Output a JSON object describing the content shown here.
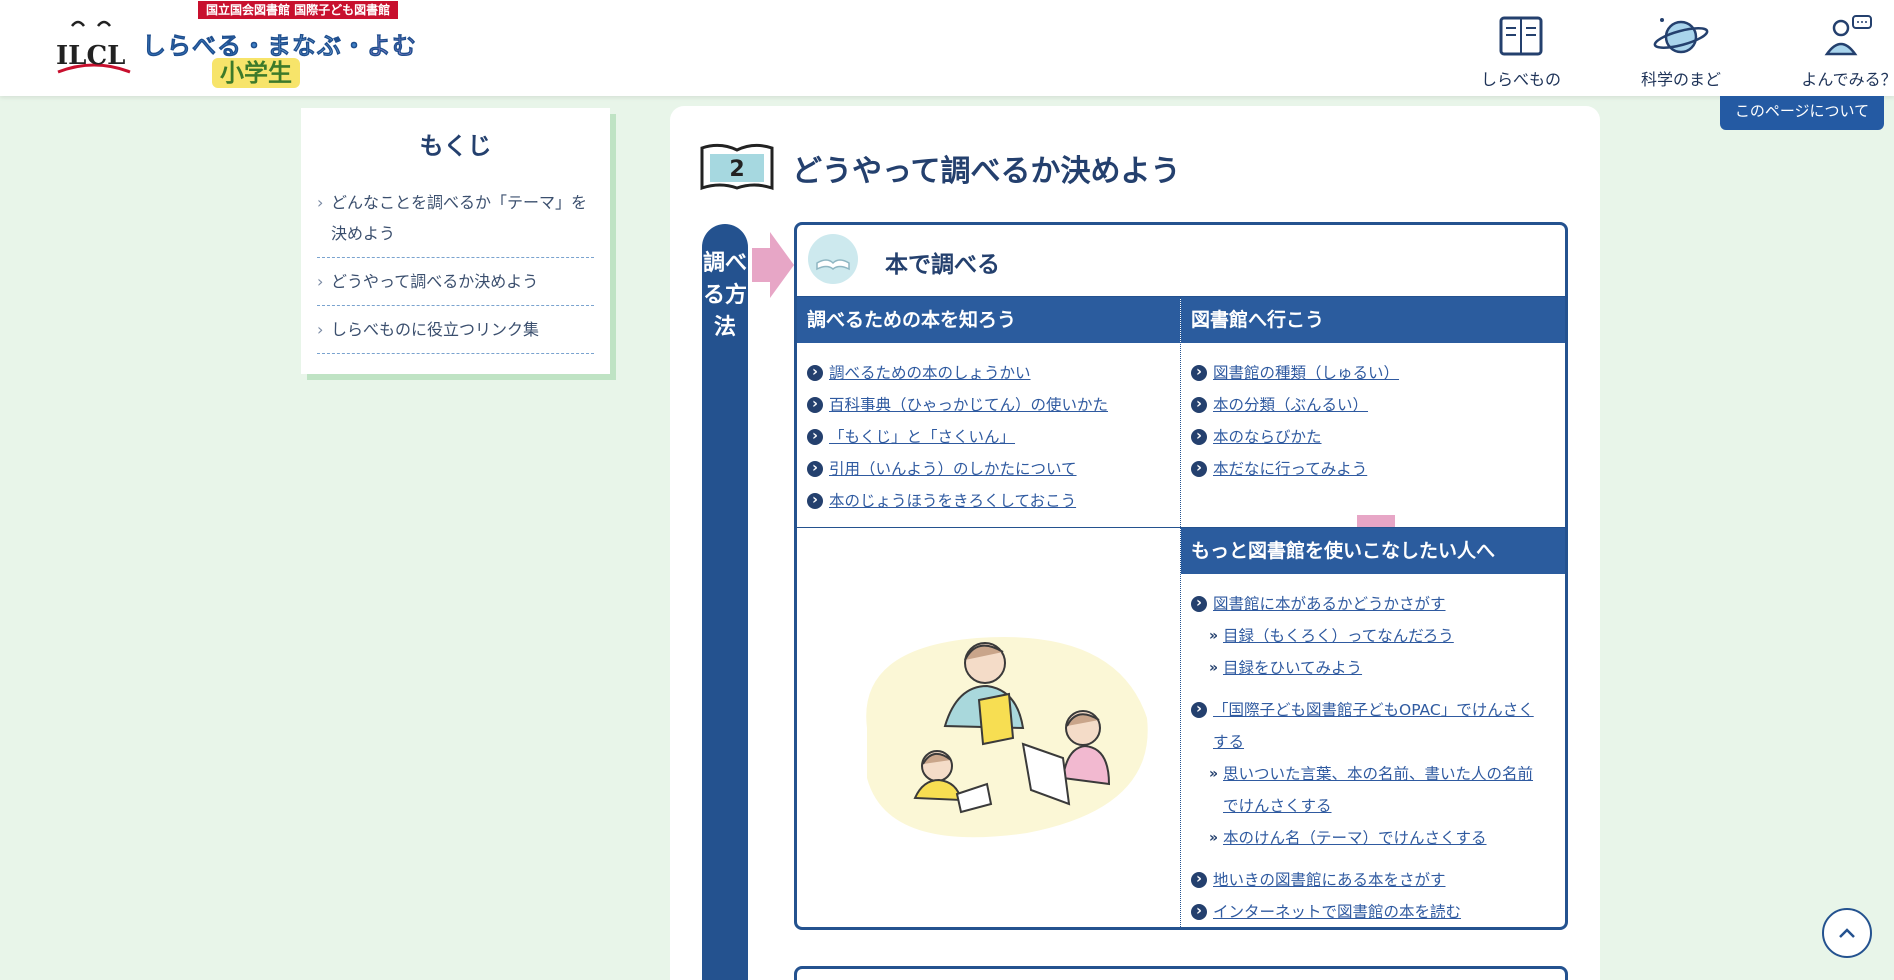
{
  "header": {
    "logo_mark": "ILCL",
    "logo_tag": "国立国会図書館 国際子ども図書館",
    "logo_title_1": "しらべる",
    "logo_title_2": "まなぶ",
    "logo_title_3": "よむ",
    "logo_sep": "・",
    "logo_subtitle": "小学生",
    "nav": [
      {
        "label": "しらべもの",
        "icon": "book-icon"
      },
      {
        "label": "科学のまど",
        "icon": "planet-icon"
      },
      {
        "label": "よんでみる？",
        "icon": "reader-icon"
      }
    ],
    "about_label": "このページについて"
  },
  "toc": {
    "title": "もくじ",
    "items": [
      "どんなことを調べるか「テーマ」を決めよう",
      "どうやって調べるか決めよう",
      "しらべものに役立つリンク集"
    ]
  },
  "section": {
    "number": "2",
    "title": "どうやって調べるか決めよう",
    "side_label": "調べる方法",
    "box_title": "本で調べる",
    "col1_header": "調べるための本を知ろう",
    "col1_links": [
      "調べるための本のしょうかい",
      "百科事典（ひゃっかじてん）の使いかた",
      "「もくじ」と「さくいん」",
      "引用（いんよう）のしかたについて",
      "本のじょうほうをきろくしておこう"
    ],
    "col2_header": "図書館へ行こう",
    "col2_links": [
      "図書館の種類（しゅるい）",
      "本の分類（ぶんるい）",
      "本のならびかた",
      "本だなに行ってみよう"
    ],
    "col3_header": "もっと図書館を使いこなしたい人へ",
    "col3_link1": "図書館に本があるかどうかさがす",
    "col3_sub1": [
      "目録（もくろく）ってなんだろう",
      "目録をひいてみよう"
    ],
    "col3_link2": "「国際子ども図書館子どもOPAC」でけんさくする",
    "col3_sub2": [
      "思いついた言葉、本の名前、書いた人の名前でけんさくする",
      "本のけん名（テーマ）でけんさくする"
    ],
    "col3_link3": "地いきの図書館にある本をさがす",
    "col3_link4": "インターネットで図書館の本を読む"
  },
  "top_button": "^",
  "colors": {
    "navy": "#24528f",
    "header_blue": "#2b5c9e",
    "pink": "#e7a6c6",
    "bg": "#e8f5e9"
  }
}
